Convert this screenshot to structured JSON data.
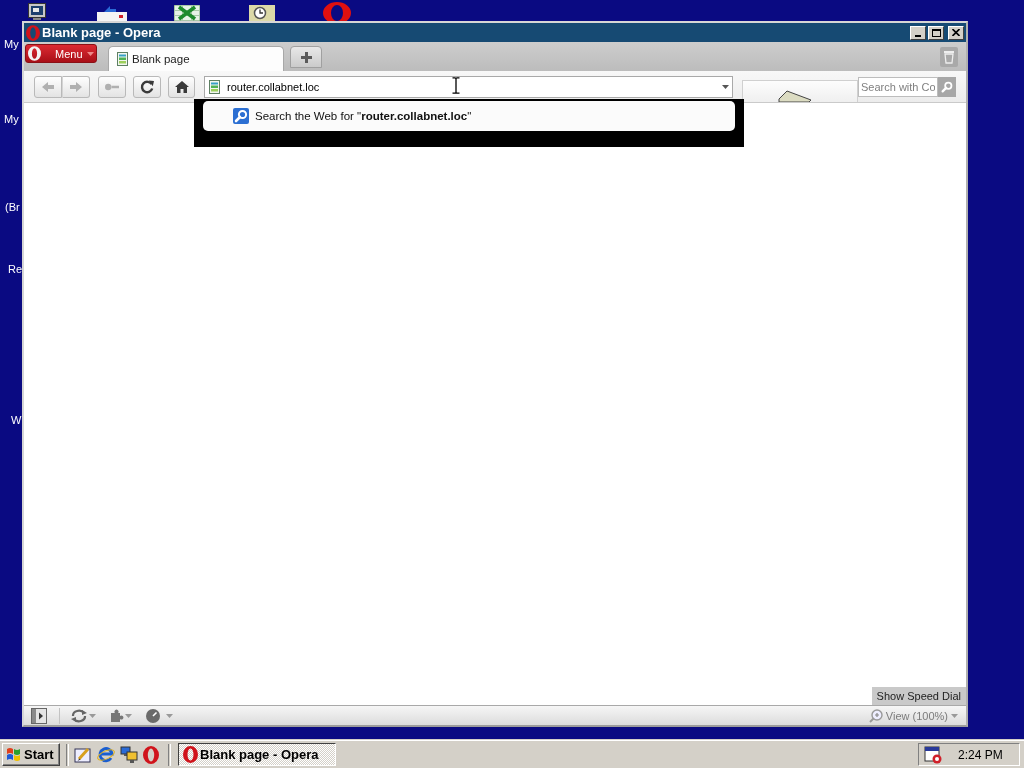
{
  "desktop": {
    "labels": [
      "My",
      "My",
      "(Br",
      "Re",
      "W"
    ]
  },
  "window": {
    "title": "Blank page - Opera"
  },
  "browser": {
    "menu_label": "Menu",
    "tabs": [
      {
        "label": "Blank page",
        "selected": true
      }
    ],
    "toolbar_buttons": [
      {
        "kind": "back",
        "disabled": true
      },
      {
        "kind": "forward",
        "disabled": true
      },
      {
        "kind": "key",
        "disabled": true
      },
      {
        "kind": "reload",
        "disabled": false
      },
      {
        "kind": "home",
        "disabled": false
      }
    ],
    "address": {
      "value": "router.collabnet.loc"
    },
    "search": {
      "placeholder": "Search with Co"
    },
    "suggestions": [
      {
        "text": "Search the Web for \"**router.collabnet.loc**\""
      }
    ],
    "speed_dial_button": "Show Speed Dial",
    "zoom": "View (100%)"
  },
  "taskbar": {
    "start": "Start",
    "tasks": [
      {
        "label": "Blank page - Opera",
        "selected": true
      }
    ],
    "clock": "2:24 PM"
  }
}
